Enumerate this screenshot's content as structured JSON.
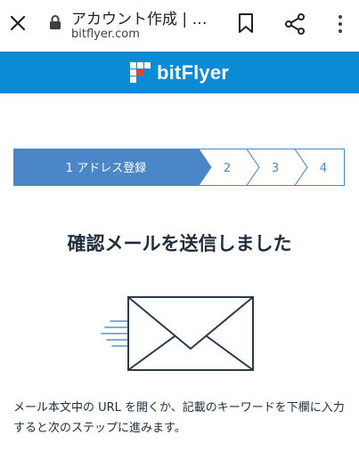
{
  "browser": {
    "title": "アカウント作成 | …",
    "url": "bitflyer.com"
  },
  "brand": {
    "name": "bitFlyer",
    "color": "#0a8bd3"
  },
  "stepper": {
    "active_color": "#4a86c8",
    "steps": [
      {
        "label": "1 アドレス登録",
        "active": true
      },
      {
        "label": "2",
        "active": false
      },
      {
        "label": "3",
        "active": false
      },
      {
        "label": "4",
        "active": false
      }
    ]
  },
  "main": {
    "title": "確認メールを送信しました",
    "description": "メール本文中の URL を開くか、記載のキーワードを下欄に入力すると次のステップに進みます。"
  }
}
